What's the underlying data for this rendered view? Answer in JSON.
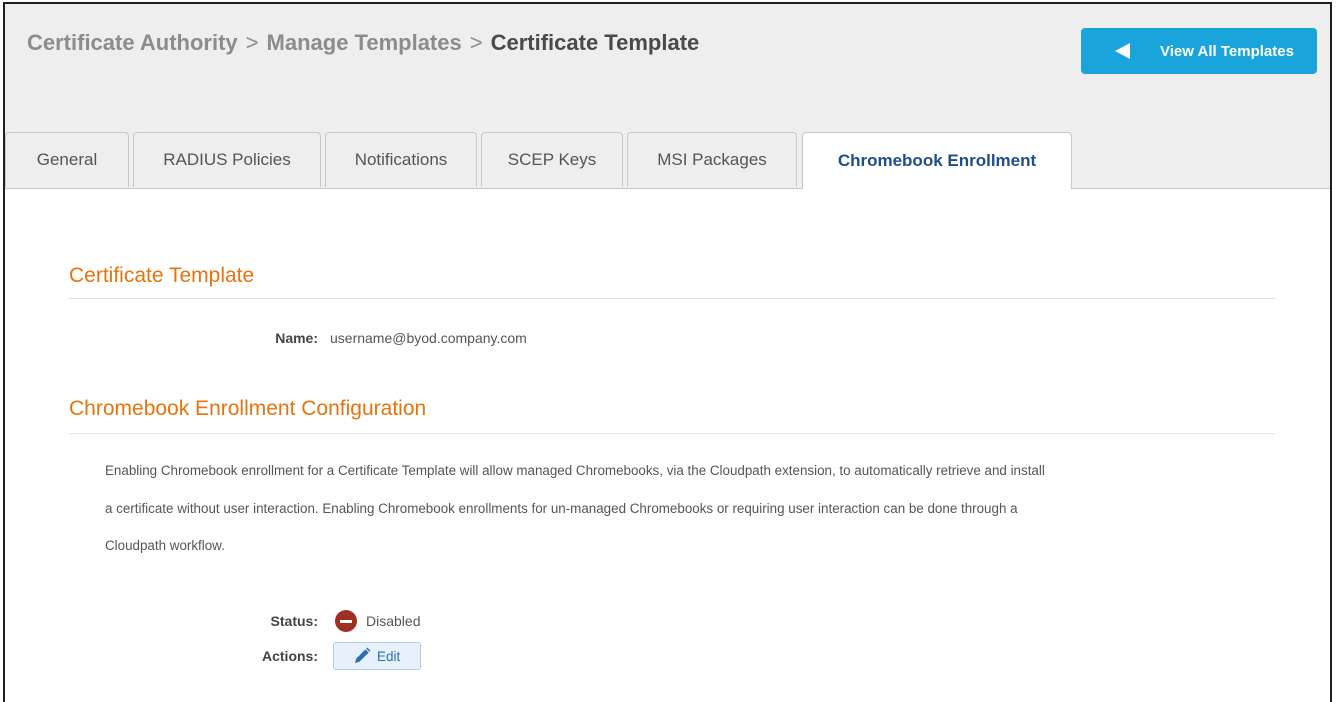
{
  "header": {
    "breadcrumb": [
      {
        "label": "Certificate Authority"
      },
      {
        "label": "Manage Templates"
      },
      {
        "label": "Certificate Template"
      }
    ],
    "separator": ">",
    "view_all_label": "View All Templates"
  },
  "tabs": [
    {
      "label": "General"
    },
    {
      "label": "RADIUS Policies"
    },
    {
      "label": "Notifications"
    },
    {
      "label": "SCEP Keys"
    },
    {
      "label": "MSI Packages"
    },
    {
      "label": "Chromebook Enrollment",
      "active": true
    }
  ],
  "certificate_section": {
    "title": "Certificate Template",
    "name_label": "Name:",
    "name_value": "username@byod.company.com"
  },
  "chromebook_section": {
    "title": "Chromebook Enrollment Configuration",
    "description_lines": [
      "Enabling Chromebook enrollment for a Certificate Template will allow managed Chromebooks, via the Cloudpath extension, to automatically retrieve and install",
      "a certificate without user interaction. Enabling Chromebook enrollments for un-managed Chromebooks or requiring user interaction can be done through a",
      "Cloudpath workflow."
    ],
    "status_label": "Status:",
    "status_value": "Disabled",
    "status_icon": "disabled-circle-icon",
    "actions_label": "Actions:",
    "edit_label": "Edit",
    "edit_icon": "pencil-icon"
  },
  "colors": {
    "accent_orange": "#e8730c",
    "button_blue": "#1aa4dc",
    "active_tab_text": "#1f4e8c",
    "status_disabled": "#9e2f22"
  }
}
